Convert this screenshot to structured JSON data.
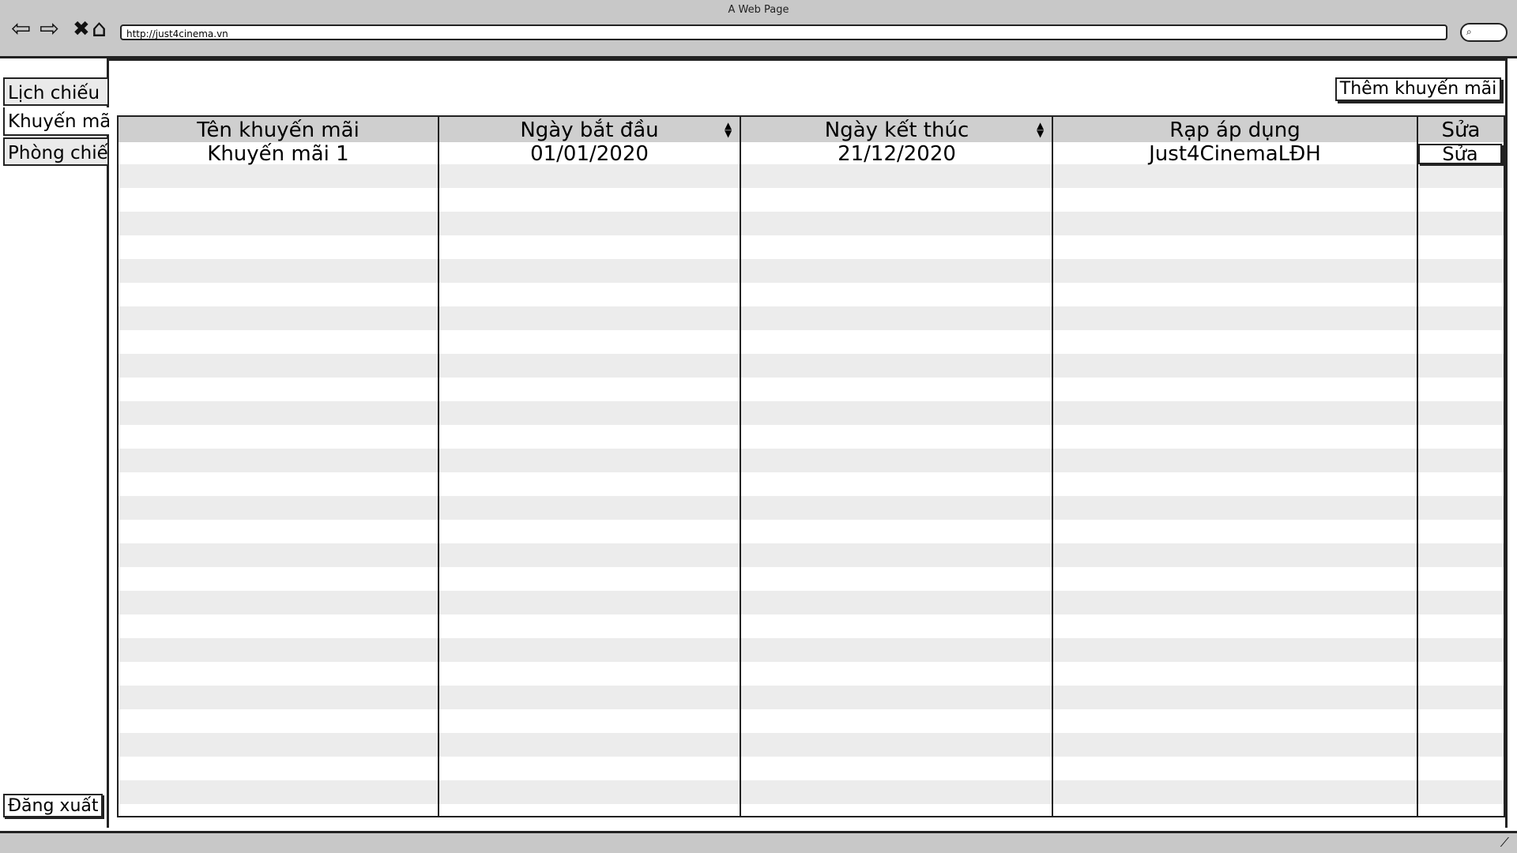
{
  "browser": {
    "title": "A Web Page",
    "url": "http://just4cinema.vn"
  },
  "sidebar": {
    "items": [
      {
        "label": "Lịch chiếu"
      },
      {
        "label": "Khuyến mãi"
      },
      {
        "label": "Phòng chiếu"
      }
    ],
    "logout_label": "Đăng xuất"
  },
  "toolbar": {
    "add_label": "Thêm khuyến mãi"
  },
  "table": {
    "columns": [
      "Tên khuyến mãi",
      "Ngày bắt đầu",
      "Ngày kết thúc",
      "Rạp áp dụng",
      "Sửa"
    ],
    "rows": [
      {
        "name": "Khuyến mãi 1",
        "start": "01/01/2020",
        "end": "21/12/2020",
        "cinema": "Just4CinemaLĐH",
        "action": "Sửa"
      }
    ]
  },
  "icons": [
    "back-icon",
    "forward-icon",
    "close-icon",
    "home-icon",
    "search-icon",
    "resize-grip-icon"
  ]
}
